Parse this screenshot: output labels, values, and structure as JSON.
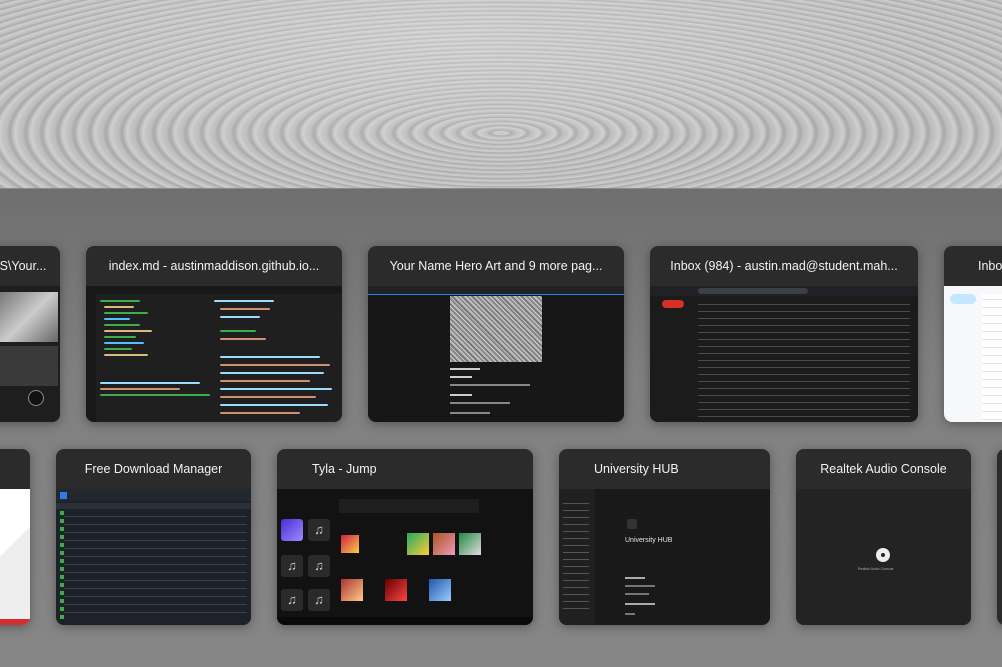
{
  "task_view": {
    "row1": [
      {
        "title": "S\\Your..."
      },
      {
        "title": "index.md - austinmaddison.github.io..."
      },
      {
        "title": "Your Name Hero Art and 9 more pag..."
      },
      {
        "title": "Inbox (984) - austin.mad@student.mah..."
      },
      {
        "title": "Inbo"
      }
    ],
    "row2": [
      {
        "title": "Free Download Manager"
      },
      {
        "title": "Tyla - Jump"
      },
      {
        "title": "University HUB"
      },
      {
        "title": "Realtek Audio Console"
      }
    ]
  },
  "thumbs": {
    "university_heading": "University HUB",
    "realtek_label": "Realtek Audio Console"
  },
  "colors": {
    "accent_blue": "#2b7de9",
    "card_bg": "#2b2b2b",
    "vscode_green": "#3fae4a",
    "gmail_red": "#d93025"
  }
}
